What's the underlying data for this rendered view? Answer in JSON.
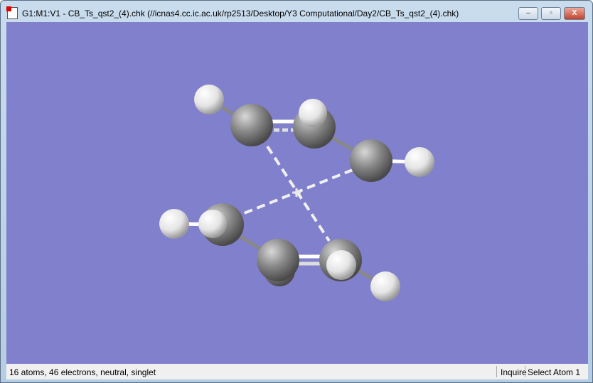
{
  "window": {
    "title": "G1:M1:V1 - CB_Ts_qst2_(4).chk (//icnas4.cc.ic.ac.uk/rp2513/Desktop/Y3 Computational/Day2/CB_Ts_qst2_(4).chk)",
    "minimize": "–",
    "maximize": "▫",
    "close": "X"
  },
  "status": {
    "info": "16 atoms, 46 electrons, neutral, singlet",
    "mode": "Inquire",
    "action": "Select Atom 1"
  },
  "colors": {
    "background": "#8080cc",
    "carbon": "#808080",
    "hydrogen": "#f0f0f0"
  }
}
